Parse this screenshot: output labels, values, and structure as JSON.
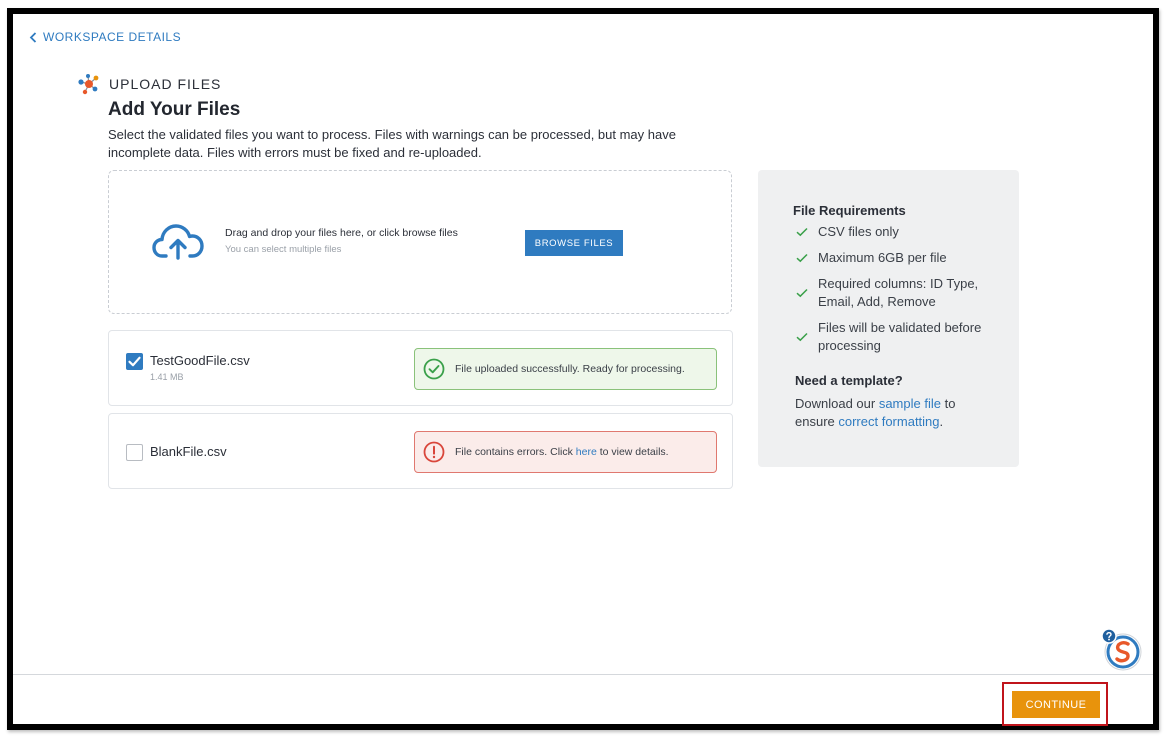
{
  "nav": {
    "back_label": "WORKSPACE DETAILS"
  },
  "header": {
    "section_label": "UPLOAD FILES",
    "title": "Add Your Files",
    "description": "Select the validated files you want to process. Files with warnings can be processed, but may have incomplete data. Files with errors must be fixed and re-uploaded."
  },
  "dropzone": {
    "main_text": "Drag and drop your files here, or click browse files",
    "sub_text": "You can select multiple files",
    "browse_label": "BROWSE FILES"
  },
  "files": [
    {
      "name": "TestGoodFile.csv",
      "size": "1.41 MB",
      "checked": true,
      "status": "success",
      "message": "File uploaded successfully. Ready for processing."
    },
    {
      "name": "BlankFile.csv",
      "size": "",
      "checked": false,
      "status": "error",
      "message_prefix": "File contains errors. Click ",
      "message_link": "here",
      "message_suffix": " to view details."
    }
  ],
  "requirements": {
    "title": "File Requirements",
    "items": [
      "CSV files only",
      "Maximum 6GB per file",
      "Required columns: ID Type, Email, Add, Remove",
      "Files will be validated before processing"
    ],
    "template_title": "Need a template?",
    "template_prefix": "Download our ",
    "template_link1": "sample file",
    "template_mid": " to ensure ",
    "template_link2": "correct formatting",
    "template_suffix": "."
  },
  "footer": {
    "continue_label": "CONTINUE"
  },
  "icons": {
    "back": "chevron-left-icon",
    "section": "network-icon",
    "upload": "cloud-upload-icon",
    "check": "check-icon",
    "success": "check-circle-icon",
    "error": "error-circle-icon",
    "help": "help-badge-icon"
  },
  "colors": {
    "accent": "#2f7bc0",
    "continue": "#e8930c",
    "success_border": "#8ac27a",
    "error_border": "#e0786f",
    "tick": "#3aa04a",
    "highlight": "#c0141b"
  }
}
